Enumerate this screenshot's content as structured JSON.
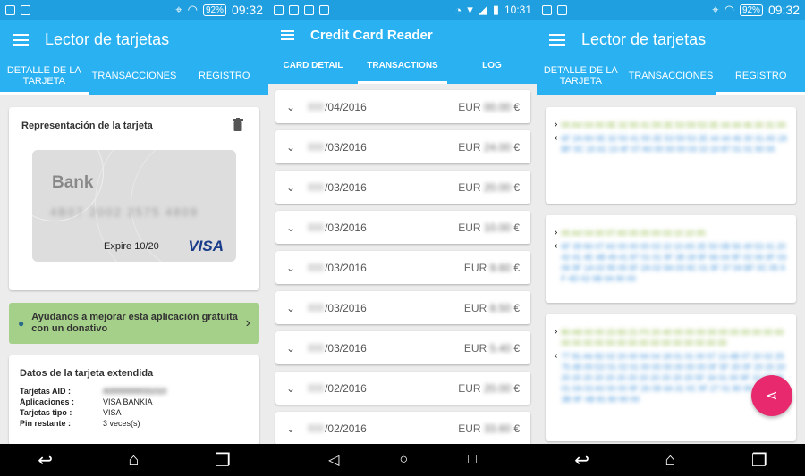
{
  "screen1": {
    "status": {
      "battery": "92%",
      "time": "09:32"
    },
    "title": "Lector de tarjetas",
    "tabs": [
      "DETALLE DE LA TARJETA",
      "TRANSACCIONES",
      "REGISTRO"
    ],
    "card_panel": {
      "heading": "Representación de la tarjeta",
      "bank": "Bank",
      "number": "4B07 2002 2575 4809",
      "expire": "Expire 10/20",
      "brand": "VISA"
    },
    "donate_text": "Ayúdanos a mejorar esta aplicación gratuita con un donativo",
    "extended": {
      "heading": "Datos de la tarjeta extendida",
      "rows": [
        {
          "key": "Tarjetas AID :",
          "value": "A0000000031010"
        },
        {
          "key": "Aplicaciones :",
          "value": "VISA BANKIA"
        },
        {
          "key": "Tarjetas tipo :",
          "value": "VISA"
        },
        {
          "key": "Pin restante :",
          "value": "3 veces(s)"
        }
      ]
    }
  },
  "screen2": {
    "status": {
      "time": "10:31"
    },
    "title": "Credit Card Reader",
    "tabs": [
      "CARD DETAIL",
      "TRANSACTIONS",
      "LOG"
    ],
    "transactions": [
      {
        "date": "/04/2016",
        "currency": "EUR",
        "amount": "00.00",
        "symbol": "€"
      },
      {
        "date": "/03/2016",
        "currency": "EUR",
        "amount": "24.00",
        "symbol": "€"
      },
      {
        "date": "/03/2016",
        "currency": "EUR",
        "amount": "20.00",
        "symbol": "€"
      },
      {
        "date": "/03/2016",
        "currency": "EUR",
        "amount": "10.00",
        "symbol": "€"
      },
      {
        "date": "/03/2016",
        "currency": "EUR",
        "amount": "9.60",
        "symbol": "€"
      },
      {
        "date": "/03/2016",
        "currency": "EUR",
        "amount": "8.50",
        "symbol": "€"
      },
      {
        "date": "/03/2016",
        "currency": "EUR",
        "amount": "5.40",
        "symbol": "€"
      },
      {
        "date": "/02/2016",
        "currency": "EUR",
        "amount": "20.00",
        "symbol": "€"
      },
      {
        "date": "/02/2016",
        "currency": "EUR",
        "amount": "33.60",
        "symbol": "€"
      }
    ]
  },
  "screen3": {
    "status": {
      "battery": "92%",
      "time": "09:32"
    },
    "title": "Lector de tarjetas",
    "tabs": [
      "DETALLE DE LA TARJETA",
      "TRANSACCIONES",
      "REGISTRO"
    ],
    "log": [
      {
        "sent": "00 A4 04 00 0E 32 50 41 59 2E 53 59 53 2E 44 44 46 30 31 00",
        "recv": "6F 2A 84 0E 32 50 41 59 2E 53 59 53 2E 44 44 46 30 31 A5 18 BF 0C 15 61 13 4F 07 A0 00 00 00 03 10 10 87 01 01 90 00"
      },
      {
        "sent": "00 A4 04 00 07 A0 00 00 00 03 10 10 00",
        "recv": "6F 39 84 07 A0 00 00 00 03 10 10 A5 2E 50 0B 56 49 53 41 20 42 41 4E 4B 49 41 87 01 01 9F 38 18 9F 66 04 9F 02 06 9F 03 06 9F 1A 02 95 05 5F 2A 02 9A 03 9C 01 9F 37 04 BF 0C 05 9F 4D 02 0B 0A 90 00"
      },
      {
        "sent": "80 A8 00 00 23 83 21 F0 20 40 00 00 00 00 00 00 00 00 00 00 00 00 00 00 00 00 00 00 00 00 00 00 00 00 00",
        "recv": "77 81 A6 82 02 20 00 94 04 18 01 01 00 57 13 4B 07 20 02 25 75 48 09 D2 01 02 01 00 00 00 00 00 00 0F 5F 20 0F 20 20 20 20 20 20 20 20 20 20 20 20 20 20 20 5F 34 01 00 9F 10 07 06 01 0A 03 A0 00 00 9F 26 08 4A 31 0C 9F 27 01 80 9F 36 02 00 3B 9F 4B 81 80 90 00"
      }
    ]
  },
  "fab_icon": "share-icon",
  "colors": {
    "primary": "#29b1f2",
    "status": "#1f9fe0",
    "donate": "#a5d089",
    "fab": "#e8296e"
  }
}
